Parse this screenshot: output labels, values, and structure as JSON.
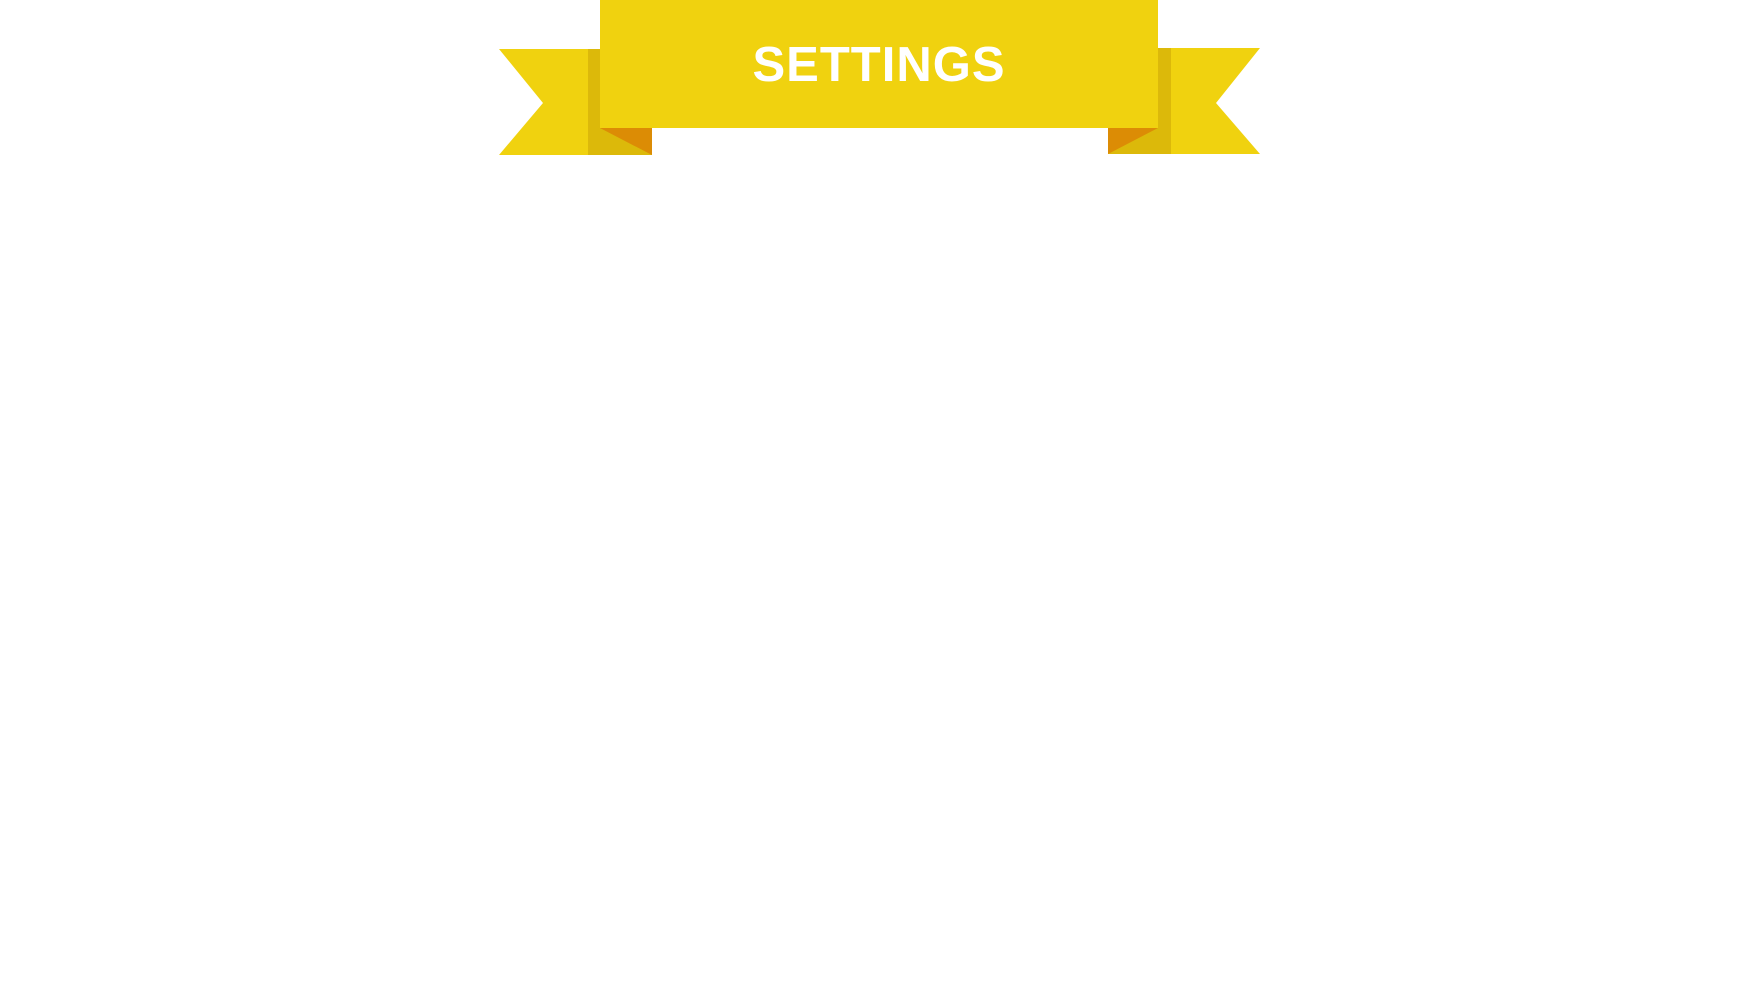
{
  "screen": {
    "title": "SETTINGS"
  },
  "colors": {
    "background": "#ffffff",
    "ribbon_main": "#f0d20f",
    "ribbon_shade": "#dcb90a",
    "ribbon_fold": "#dc8c05",
    "title_text": "#ffffff"
  }
}
